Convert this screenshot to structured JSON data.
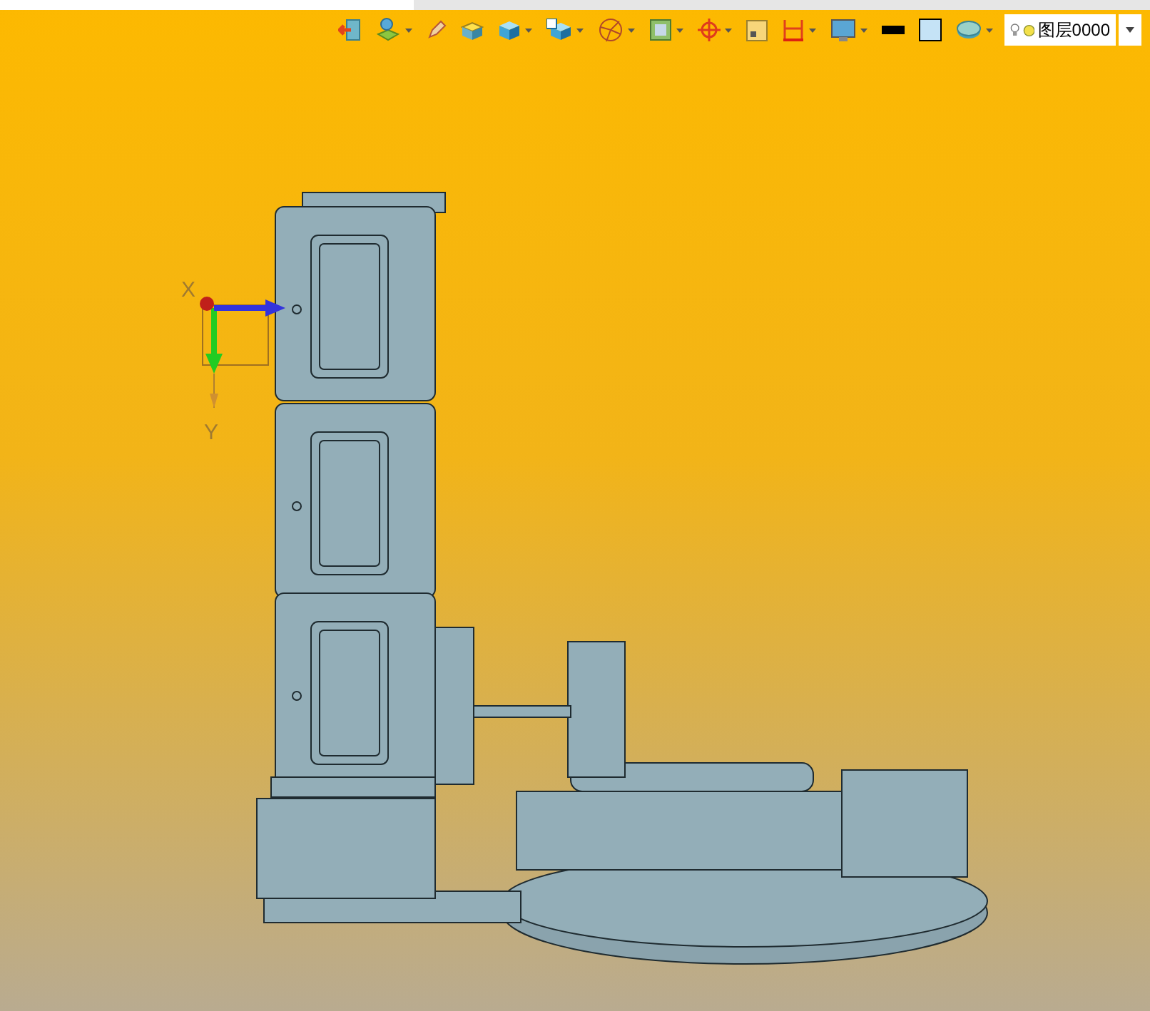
{
  "toolbar": [
    {
      "has_menu": false
    },
    {
      "has_menu": true
    },
    {
      "has_menu": false
    },
    {
      "has_menu": false
    },
    {
      "has_menu": true
    },
    {
      "has_menu": true
    },
    {
      "has_menu": true
    },
    {
      "has_menu": true
    },
    {
      "has_menu": true
    },
    {
      "has_menu": false
    },
    {
      "has_menu": true
    },
    {
      "has_menu": true
    },
    {
      "has_menu": false
    },
    {
      "has_menu": false
    },
    {
      "has_menu": true
    }
  ],
  "layer_selector": {
    "value": "图层0000"
  },
  "axis_labels": [
    "X",
    "Y"
  ]
}
